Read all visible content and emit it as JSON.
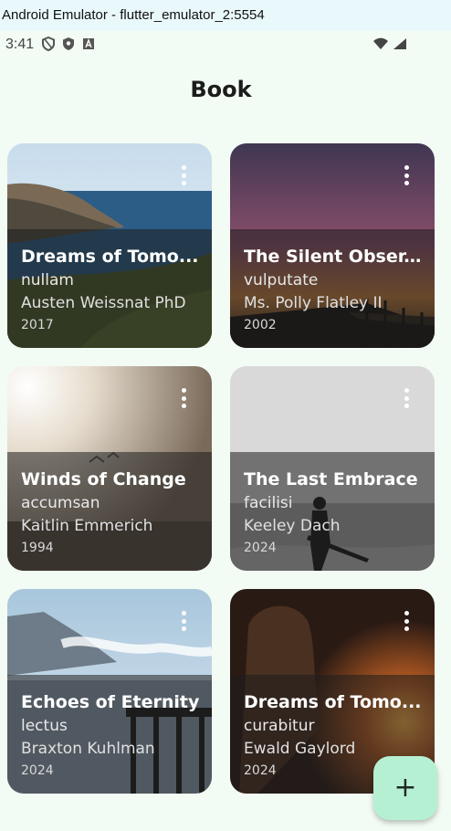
{
  "window": {
    "title": "Android Emulator - flutter_emulator_2:5554"
  },
  "status_bar": {
    "time": "3:41",
    "left_icons": [
      "shield-outline-icon",
      "shield-filled-icon",
      "font-a-icon"
    ],
    "right_icons": [
      "wifi-icon",
      "signal-icon"
    ]
  },
  "page": {
    "title": "Book"
  },
  "books": [
    {
      "title": "Dreams of Tomo...",
      "subtitle": "nullam",
      "author": "Austen Weissnat PhD",
      "year": "2017",
      "image": "coastal-cliff-sea"
    },
    {
      "title": "The Silent Obser...",
      "subtitle": "vulputate",
      "author": "Ms. Polly Flatley II",
      "year": "2002",
      "image": "pier-sunset"
    },
    {
      "title": "Winds of Change",
      "subtitle": "accumsan",
      "author": "Kaitlin Emmerich",
      "year": "1994",
      "image": "misty-sunlight-birds"
    },
    {
      "title": "The Last Embrace",
      "subtitle": "facilisi",
      "author": "Keeley Dach",
      "year": "2024",
      "image": "guitarist-on-shore"
    },
    {
      "title": "Echoes of Eternity",
      "subtitle": "lectus",
      "author": "Braxton Kuhlman",
      "year": "2024",
      "image": "mountain-dock"
    },
    {
      "title": "Dreams of Tomo...",
      "subtitle": "curabitur",
      "author": "Ewald Gaylord",
      "year": "2024",
      "image": "girl-by-campfire"
    }
  ],
  "fab": {
    "label": "+",
    "icon": "plus-icon",
    "color": "#b6f0d3"
  },
  "colors": {
    "background": "#f2fbf4",
    "window_bar": "#e9f8fb"
  }
}
